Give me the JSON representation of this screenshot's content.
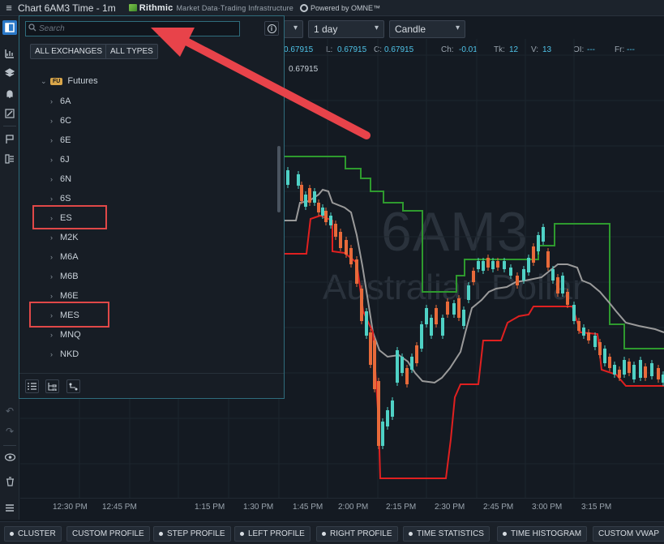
{
  "title": {
    "text": "Chart 6AM3 Time - 1m",
    "brand_rithmic": "Rithmic",
    "brand_tagline": "Market Data·Trading Infrastructure",
    "brand_omne": "Powered by OMNE™"
  },
  "toolbar": {
    "period": "1 day",
    "chart_type": "Candle"
  },
  "quotes": {
    "open_partial": "0.67915",
    "low_label": "L:",
    "low": "0.67915",
    "close_label": "C:",
    "close": "0.67915",
    "change_label": "Ch:",
    "change": "-0.01",
    "ticks_label": "Tk:",
    "ticks": "12",
    "volume_label": "V:",
    "volume": "13",
    "oi_label": "OI:",
    "oi": "---",
    "fr_label": "Fr:",
    "fr": "---",
    "last": "0.67915"
  },
  "watermark": {
    "symbol": "6AM3",
    "name": "Australian Dollar"
  },
  "symbol_panel": {
    "search_placeholder": "Search",
    "filter_exchanges": "ALL EXCHANGES",
    "filter_types": "ALL TYPES",
    "group_badge": "FU",
    "group_label": "Futures",
    "items": [
      "6A",
      "6C",
      "6E",
      "6J",
      "6N",
      "6S",
      "ES",
      "M2K",
      "M6A",
      "M6B",
      "M6E",
      "MES",
      "MNQ",
      "NKD"
    ]
  },
  "x_axis_ticks": [
    "12:30 PM",
    "12:45 PM",
    "1:15 PM",
    "1:30 PM",
    "1:45 PM",
    "2:00 PM",
    "2:15 PM",
    "2:30 PM",
    "2:45 PM",
    "3:00 PM",
    "3:15 PM"
  ],
  "bottom_buttons": {
    "cluster": "CLUSTER",
    "custom_profile": "CUSTOM PROFILE",
    "step_profile": "STEP PROFILE",
    "left_profile": "LEFT PROFILE",
    "right_profile": "RIGHT PROFILE",
    "time_statistics": "TIME STATISTICS",
    "time_histogram": "TIME HISTOGRAM",
    "custom_vwap": "CUSTOM VWAP"
  },
  "colors": {
    "accent": "#2a78c8",
    "highlight": "#e04848",
    "candle_up": "#4fd1c5",
    "candle_down": "#e86a3a",
    "channel_upper": "#2e9a2e",
    "channel_lower": "#e02020",
    "channel_mid": "#9a9a9a"
  }
}
